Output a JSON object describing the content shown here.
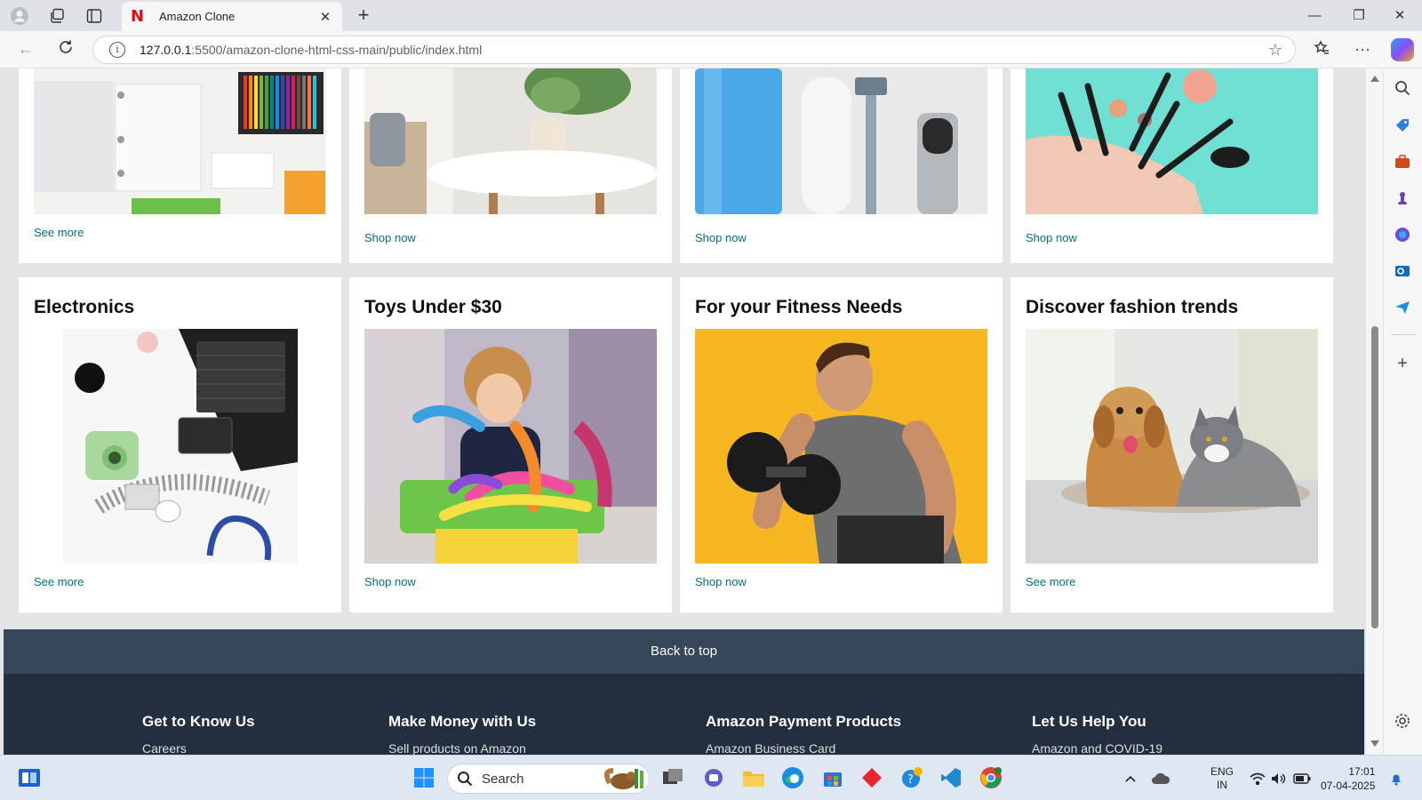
{
  "browser": {
    "tab_title": "Amazon Clone",
    "tab_favicon": "N",
    "url_host": "127.0.0.1",
    "url_path": ":5500/amazon-clone-html-css-main/public/index.html"
  },
  "top_row_cards": [
    {
      "link": "See more",
      "image": "stationery-binder-pencils"
    },
    {
      "link": "Shop now",
      "image": "home-decor-vase"
    },
    {
      "link": "Shop now",
      "image": "grooming-razor-bottles"
    },
    {
      "link": "Shop now",
      "image": "makeup-brushes-pouch"
    }
  ],
  "cards": [
    {
      "title": "Electronics",
      "link": "See more",
      "image": "laptop-camera-headphones"
    },
    {
      "title": "Toys Under $30",
      "link": "Shop now",
      "image": "child-playing-toys"
    },
    {
      "title": "For your Fitness Needs",
      "link": "Shop now",
      "image": "man-lifting-dumbbell"
    },
    {
      "title": "Discover fashion trends",
      "link": "See more",
      "image": "dog-and-cat"
    }
  ],
  "back_to_top": "Back to top",
  "footer": {
    "columns": [
      {
        "heading": "Get to Know Us",
        "first_item": "Careers"
      },
      {
        "heading": "Make Money with Us",
        "first_item": "Sell products on Amazon"
      },
      {
        "heading": "Amazon Payment Products",
        "first_item": "Amazon Business Card"
      },
      {
        "heading": "Let Us Help You",
        "first_item": "Amazon and COVID-19"
      }
    ]
  },
  "taskbar": {
    "search_label": "Search",
    "lang_top": "ENG",
    "lang_bottom": "IN",
    "time": "17:01",
    "date": "07-04-2025"
  },
  "colors": {
    "link": "#007185",
    "back_to_top": "#37475a",
    "footer": "#232f3e",
    "page_bg": "#e3e6e6"
  }
}
